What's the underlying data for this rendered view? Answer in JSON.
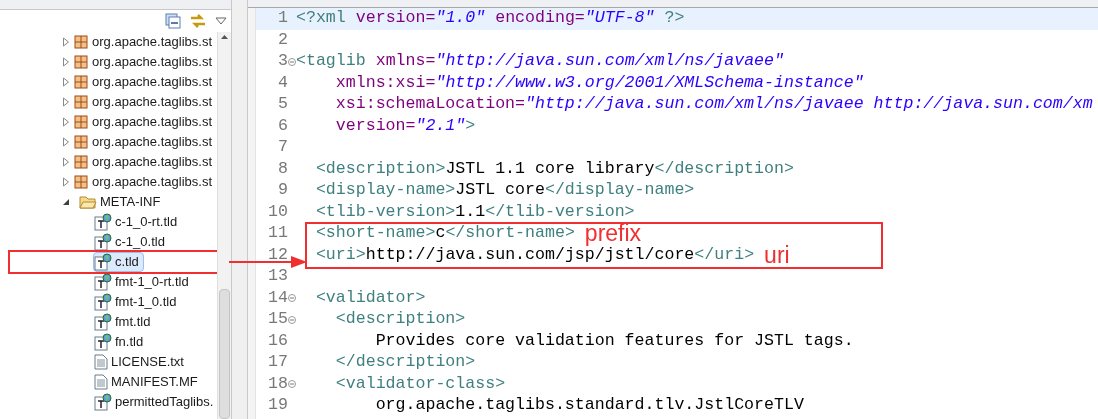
{
  "explorer": {
    "items": [
      {
        "label": "org.apache.taglibs.st",
        "kind": "package",
        "expanded": false,
        "selected": false,
        "highlighted": false
      },
      {
        "label": "org.apache.taglibs.st",
        "kind": "package",
        "expanded": false,
        "selected": false,
        "highlighted": false
      },
      {
        "label": "org.apache.taglibs.st",
        "kind": "package",
        "expanded": false,
        "selected": false,
        "highlighted": false
      },
      {
        "label": "org.apache.taglibs.st",
        "kind": "package",
        "expanded": false,
        "selected": false,
        "highlighted": false
      },
      {
        "label": "org.apache.taglibs.st",
        "kind": "package",
        "expanded": false,
        "selected": false,
        "highlighted": false
      },
      {
        "label": "org.apache.taglibs.st",
        "kind": "package",
        "expanded": false,
        "selected": false,
        "highlighted": false
      },
      {
        "label": "org.apache.taglibs.st",
        "kind": "package",
        "expanded": false,
        "selected": false,
        "highlighted": false
      },
      {
        "label": "org.apache.taglibs.st",
        "kind": "package",
        "expanded": false,
        "selected": false,
        "highlighted": false
      },
      {
        "label": "META-INF",
        "kind": "folder",
        "expanded": true,
        "selected": false,
        "highlighted": false,
        "children": [
          {
            "label": "c-1_0-rt.tld",
            "kind": "tld",
            "selected": false,
            "highlighted": false
          },
          {
            "label": "c-1_0.tld",
            "kind": "tld",
            "selected": false,
            "highlighted": false
          },
          {
            "label": "c.tld",
            "kind": "tld",
            "selected": true,
            "highlighted": true
          },
          {
            "label": "fmt-1_0-rt.tld",
            "kind": "tld",
            "selected": false,
            "highlighted": false
          },
          {
            "label": "fmt-1_0.tld",
            "kind": "tld",
            "selected": false,
            "highlighted": false
          },
          {
            "label": "fmt.tld",
            "kind": "tld",
            "selected": false,
            "highlighted": false
          },
          {
            "label": "fn.tld",
            "kind": "tld",
            "selected": false,
            "highlighted": false
          },
          {
            "label": "LICENSE.txt",
            "kind": "text",
            "selected": false,
            "highlighted": false
          },
          {
            "label": "MANIFEST.MF",
            "kind": "text",
            "selected": false,
            "highlighted": false
          },
          {
            "label": "permittedTaglibs.",
            "kind": "tld",
            "selected": false,
            "highlighted": false
          }
        ]
      }
    ]
  },
  "editor": {
    "lines": [
      {
        "number": "1",
        "current": true,
        "collapsible": false,
        "highlighted": false,
        "tokens": [
          {
            "kind": "tag",
            "text": "<?xml"
          },
          {
            "kind": "attr",
            "text": " version="
          },
          {
            "kind": "value",
            "text": "\"1.0\""
          },
          {
            "kind": "attr",
            "text": " encoding="
          },
          {
            "kind": "value",
            "text": "\"UTF-8\""
          },
          {
            "kind": "tag",
            "text": " ?>"
          }
        ]
      },
      {
        "number": "2",
        "current": false,
        "collapsible": false,
        "highlighted": false
      },
      {
        "number": "3",
        "current": false,
        "collapsible": true,
        "highlighted": false,
        "tokens": [
          {
            "kind": "tag",
            "text": "<taglib"
          },
          {
            "kind": "attr",
            "text": " xmlns="
          },
          {
            "kind": "value",
            "text": "\"http://java.sun.com/xml/ns/javaee\""
          }
        ]
      },
      {
        "number": "4",
        "current": false,
        "collapsible": false,
        "highlighted": false,
        "tokens": [
          {
            "kind": "attr",
            "text": "    xmlns:xsi="
          },
          {
            "kind": "value",
            "text": "\"http://www.w3.org/2001/XMLSchema-instance\""
          }
        ]
      },
      {
        "number": "5",
        "current": false,
        "collapsible": false,
        "highlighted": false,
        "tokens": [
          {
            "kind": "attr",
            "text": "    xsi:schemaLocation="
          },
          {
            "kind": "value",
            "text": "\"http://java.sun.com/xml/ns/javaee http://java.sun.com/xm"
          }
        ]
      },
      {
        "number": "6",
        "current": false,
        "collapsible": false,
        "highlighted": false,
        "tokens": [
          {
            "kind": "attr",
            "text": "    version="
          },
          {
            "kind": "value",
            "text": "\"2.1\""
          },
          {
            "kind": "tag",
            "text": ">"
          }
        ]
      },
      {
        "number": "7",
        "current": false,
        "collapsible": false,
        "highlighted": false
      },
      {
        "number": "8",
        "current": false,
        "collapsible": false,
        "highlighted": false,
        "tokens": [
          {
            "kind": "tag",
            "text": "  <description>"
          },
          {
            "kind": "text",
            "text": "JSTL 1.1 core library"
          },
          {
            "kind": "tag",
            "text": "</description>"
          }
        ]
      },
      {
        "number": "9",
        "current": false,
        "collapsible": false,
        "highlighted": false,
        "tokens": [
          {
            "kind": "tag",
            "text": "  <display-name>"
          },
          {
            "kind": "text",
            "text": "JSTL core"
          },
          {
            "kind": "tag",
            "text": "</display-name>"
          }
        ]
      },
      {
        "number": "10",
        "current": false,
        "collapsible": false,
        "highlighted": false,
        "tokens": [
          {
            "kind": "tag",
            "text": "  <tlib-version>"
          },
          {
            "kind": "text",
            "text": "1.1"
          },
          {
            "kind": "tag",
            "text": "</tlib-version>"
          }
        ]
      },
      {
        "number": "11",
        "current": false,
        "collapsible": false,
        "highlighted": true,
        "note": "prefix",
        "tokens": [
          {
            "kind": "tag",
            "text": "  <short-name>"
          },
          {
            "kind": "text",
            "text": "c"
          },
          {
            "kind": "tag",
            "text": "</short-name>"
          }
        ]
      },
      {
        "number": "12",
        "current": false,
        "collapsible": false,
        "highlighted": true,
        "note": "uri",
        "tokens": [
          {
            "kind": "tag",
            "text": "  <uri>"
          },
          {
            "kind": "text",
            "text": "http://java.sun.com/jsp/jstl/core"
          },
          {
            "kind": "tag",
            "text": "</uri>"
          }
        ]
      },
      {
        "number": "13",
        "current": false,
        "collapsible": false,
        "highlighted": false
      },
      {
        "number": "14",
        "current": false,
        "collapsible": true,
        "highlighted": false,
        "tokens": [
          {
            "kind": "tag",
            "text": "  <validator>"
          }
        ]
      },
      {
        "number": "15",
        "current": false,
        "collapsible": true,
        "highlighted": false,
        "tokens": [
          {
            "kind": "tag",
            "text": "    <description>"
          }
        ]
      },
      {
        "number": "16",
        "current": false,
        "collapsible": false,
        "highlighted": false,
        "tokens": [
          {
            "kind": "text",
            "text": "        Provides core validation features for JSTL tags."
          }
        ]
      },
      {
        "number": "17",
        "current": false,
        "collapsible": false,
        "highlighted": false,
        "tokens": [
          {
            "kind": "tag",
            "text": "    </description>"
          }
        ]
      },
      {
        "number": "18",
        "current": false,
        "collapsible": true,
        "highlighted": false,
        "tokens": [
          {
            "kind": "tag",
            "text": "    <validator-class>"
          }
        ]
      },
      {
        "number": "19",
        "current": false,
        "collapsible": false,
        "highlighted": false,
        "tokens": [
          {
            "kind": "text",
            "text": "        org.apache.taglibs.standard.tlv.JstlCoreTLV"
          }
        ]
      }
    ]
  }
}
